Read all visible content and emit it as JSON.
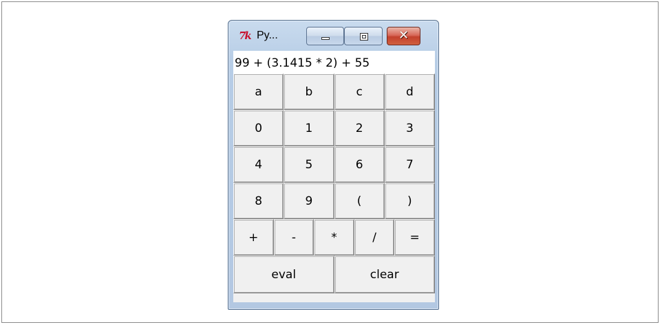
{
  "window": {
    "title": "Py...",
    "app_icon": "tk-feather-icon",
    "icon_text": "7k",
    "close_symbol": "✕"
  },
  "display": {
    "value": "99 + (3.1415 * 2) + 55"
  },
  "keypad": {
    "rows": [
      [
        "a",
        "b",
        "c",
        "d"
      ],
      [
        "0",
        "1",
        "2",
        "3"
      ],
      [
        "4",
        "5",
        "6",
        "7"
      ],
      [
        "8",
        "9",
        "(",
        ")"
      ],
      [
        "+",
        "-",
        "*",
        "/",
        "="
      ],
      [
        "eval",
        "clear"
      ]
    ]
  },
  "colors": {
    "close_button": "#c3412d",
    "title_bar": "#b7cde6",
    "button_face": "#f0f0f0"
  }
}
